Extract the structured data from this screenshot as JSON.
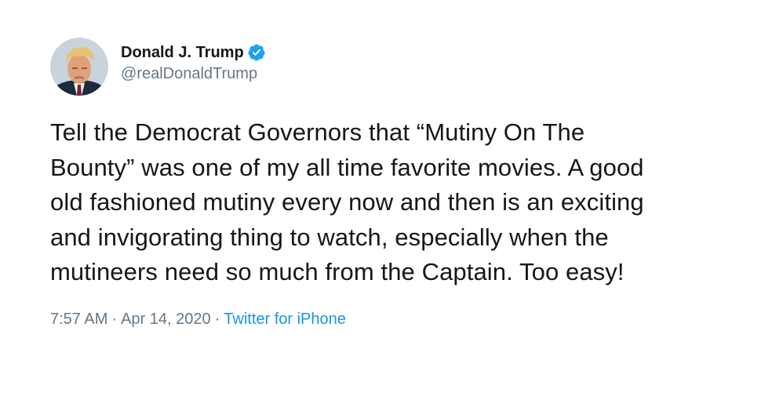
{
  "tweet": {
    "author": {
      "display_name": "Donald J. Trump",
      "handle": "@realDonaldTrump",
      "verified": true
    },
    "text_lines": [
      "Tell the Democrat Governors that “Mutiny On The",
      "Bounty” was one of my all time favorite movies. A good",
      "old fashioned mutiny every now and then is an exciting",
      "and invigorating thing to watch, especially when the",
      "mutineers need so much from the Captain. Too easy!"
    ],
    "time": "7:57 AM",
    "separator": "·",
    "date": "Apr 14, 2020",
    "source": "Twitter for iPhone"
  },
  "colors": {
    "text": "#14171a",
    "secondary": "#657786",
    "accent": "#1b95e0",
    "verified_badge": "#1da1f2"
  },
  "icons": {
    "verified": "verified-badge-icon",
    "avatar": "profile-photo"
  }
}
